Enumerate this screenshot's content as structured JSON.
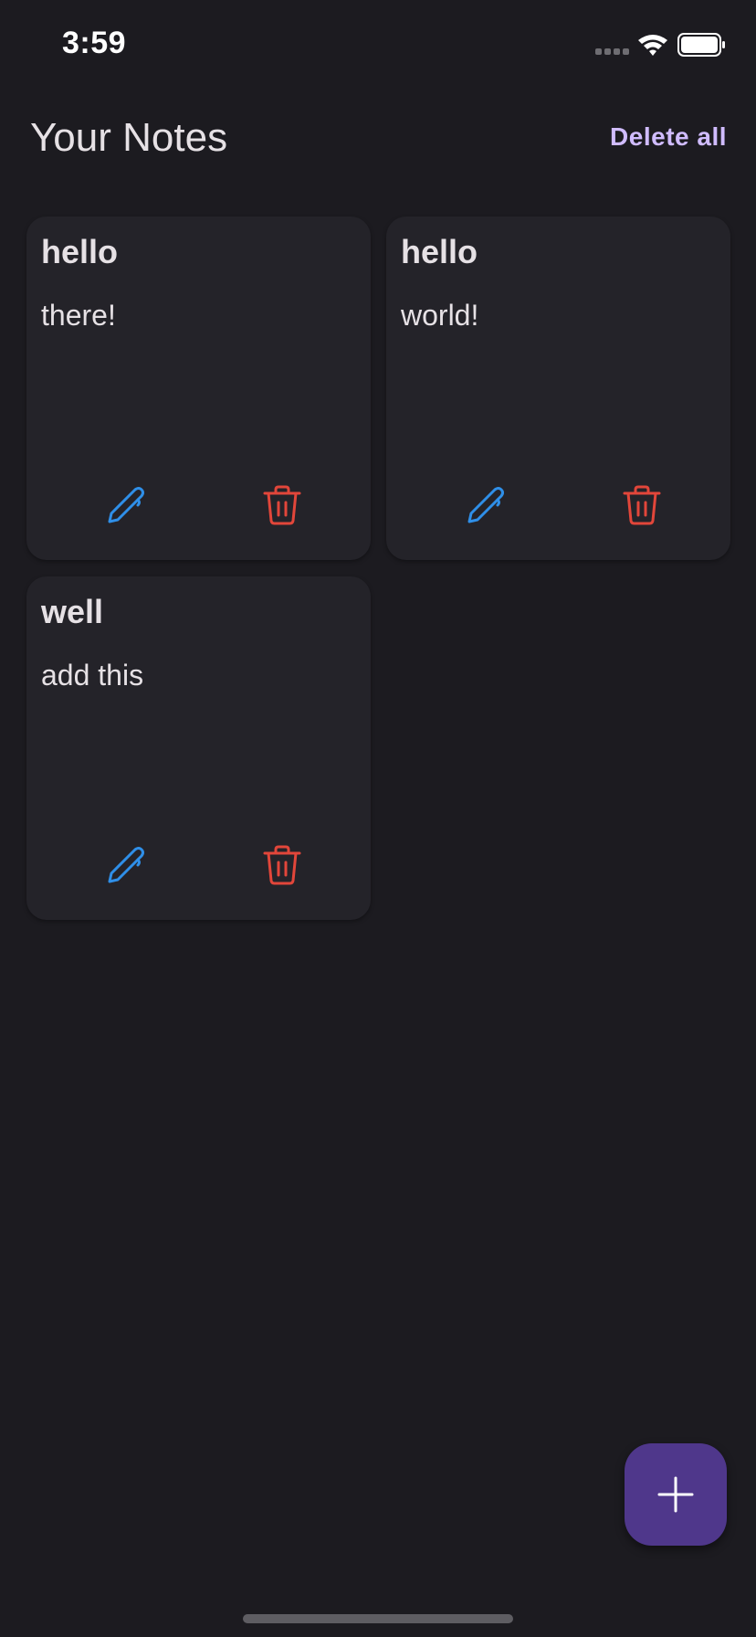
{
  "status_bar": {
    "time": "3:59"
  },
  "header": {
    "title": "Your Notes",
    "delete_all_label": "Delete all"
  },
  "notes": [
    {
      "title": "hello",
      "body": "there!"
    },
    {
      "title": "hello",
      "body": "world!"
    },
    {
      "title": "well",
      "body": "add this"
    }
  ],
  "colors": {
    "background": "#1c1b20",
    "card": "#242329",
    "accent": "#d0bcff",
    "fab": "#4f378b",
    "edit_icon": "#2f8fe8",
    "delete_icon": "#e2463a"
  },
  "icons": {
    "edit": "pencil-icon",
    "delete": "trash-icon",
    "add": "plus-icon"
  }
}
